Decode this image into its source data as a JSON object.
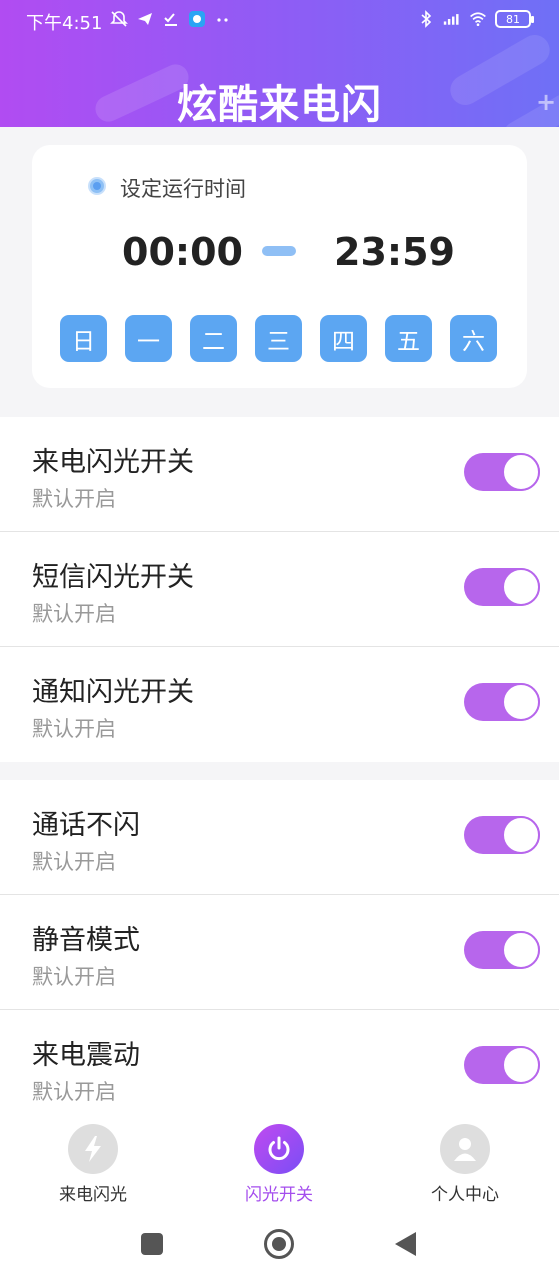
{
  "status_bar": {
    "time": "下午4:51",
    "battery": "81"
  },
  "header": {
    "title": "炫酷来电闪"
  },
  "schedule": {
    "label": "设定运行时间",
    "start_time": "00:00",
    "end_time": "23:59",
    "days": [
      "日",
      "一",
      "二",
      "三",
      "四",
      "五",
      "六"
    ]
  },
  "settings_group_1": [
    {
      "title": "来电闪光开关",
      "subtitle": "默认开启",
      "enabled": true
    },
    {
      "title": "短信闪光开关",
      "subtitle": "默认开启",
      "enabled": true
    },
    {
      "title": "通知闪光开关",
      "subtitle": "默认开启",
      "enabled": true
    }
  ],
  "settings_group_2": [
    {
      "title": "通话不闪",
      "subtitle": "默认开启",
      "enabled": true
    },
    {
      "title": "静音模式",
      "subtitle": "默认开启",
      "enabled": true
    },
    {
      "title": "来电震动",
      "subtitle": "默认开启",
      "enabled": true
    }
  ],
  "tabbar": {
    "tabs": [
      {
        "label": "来电闪光",
        "icon": "lightning-icon",
        "active": false
      },
      {
        "label": "闪光开关",
        "icon": "power-icon",
        "active": true
      },
      {
        "label": "个人中心",
        "icon": "person-icon",
        "active": false
      }
    ]
  },
  "colors": {
    "accent": "#b766ec",
    "day_button": "#5ca6f2",
    "header_gradient_start": "#b14cf2",
    "header_gradient_end": "#6f70f6"
  }
}
